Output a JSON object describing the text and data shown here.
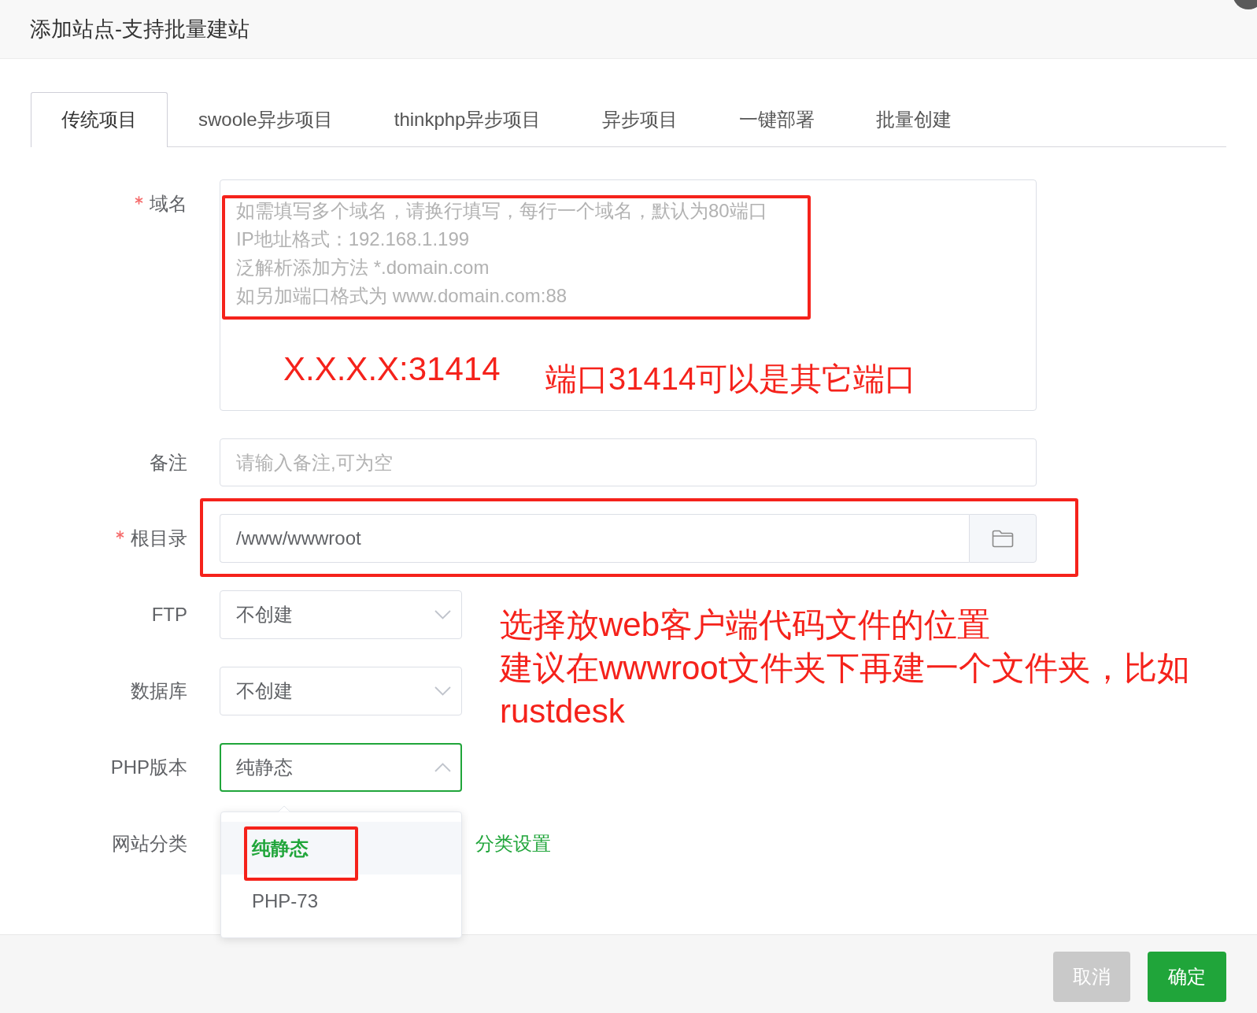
{
  "dialog": {
    "title": "添加站点-支持批量建站"
  },
  "tabs": [
    {
      "label": "传统项目",
      "selected": true
    },
    {
      "label": "swoole异步项目",
      "selected": false
    },
    {
      "label": "thinkphp异步项目",
      "selected": false
    },
    {
      "label": "异步项目",
      "selected": false
    },
    {
      "label": "一键部署",
      "selected": false
    },
    {
      "label": "批量创建",
      "selected": false
    }
  ],
  "form": {
    "fields": [
      {
        "kind": "textarea",
        "label": "域名",
        "required": true,
        "placeholder": "如需填写多个域名，请换行填写，每行一个域名，默认为80端口\nIP地址格式：192.168.1.199\n泛解析添加方法 *.domain.com\n如另加端口格式为 www.domain.com:88",
        "annotation": {
          "framed": true,
          "notes": [
            "X.X.X.X:31414",
            "端口31414可以是其它端口"
          ]
        }
      },
      {
        "kind": "input",
        "label": "备注",
        "required": false,
        "placeholder": "请输入备注,可为空"
      },
      {
        "kind": "path",
        "label": "根目录",
        "required": true,
        "value": "/www/wwwroot",
        "annotation": {
          "framed": true,
          "notes": [
            "选择放web客户端代码文件的位置",
            "建议在wwwroot文件夹下再建一个文件夹，比如",
            "rustdesk"
          ]
        }
      },
      {
        "kind": "select",
        "label": "FTP",
        "required": false,
        "value": "不创建",
        "expanded": false
      },
      {
        "kind": "select",
        "label": "数据库",
        "required": false,
        "value": "不创建",
        "expanded": false
      },
      {
        "kind": "select",
        "label": "PHP版本",
        "required": false,
        "value": "纯静态",
        "expanded": true,
        "options": [
          {
            "label": "纯静态",
            "selected": true,
            "framed": true
          },
          {
            "label": "PHP-73",
            "selected": false,
            "framed": false
          }
        ]
      },
      {
        "kind": "category",
        "label": "网站分类",
        "required": false,
        "link": "分类设置"
      }
    ]
  },
  "footer": {
    "buttons": [
      {
        "kind": "cancel",
        "label": "取消"
      },
      {
        "kind": "confirm",
        "label": "确定"
      }
    ]
  }
}
